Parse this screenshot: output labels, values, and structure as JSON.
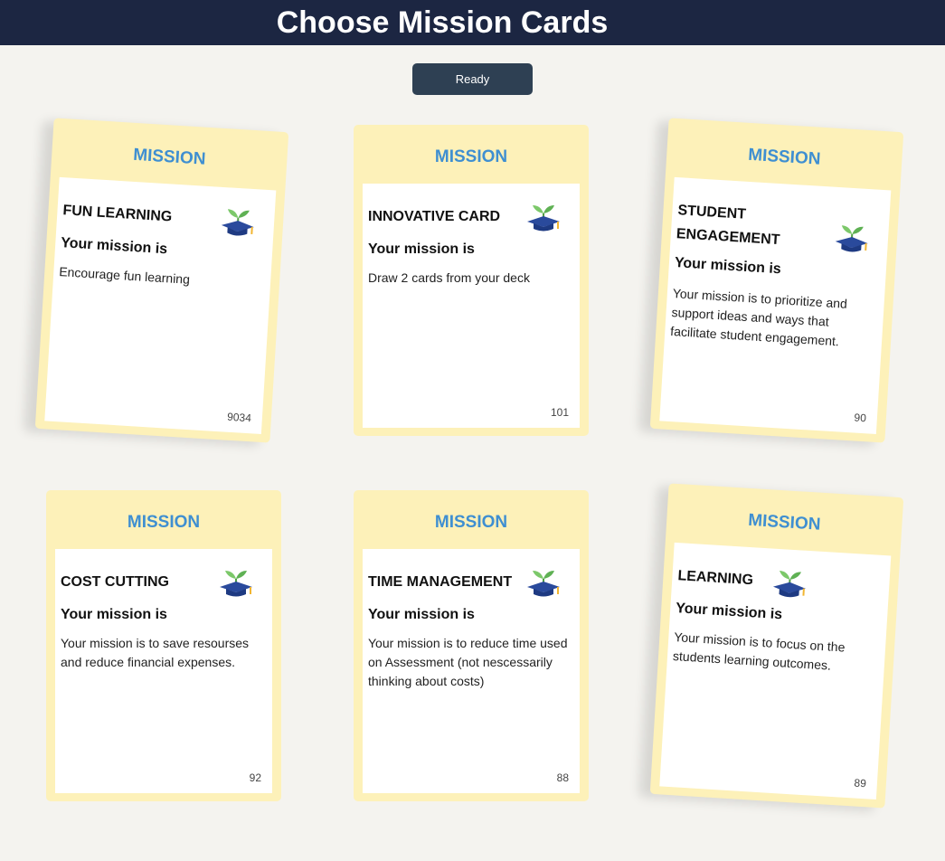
{
  "header": {
    "title": "Choose Mission Cards"
  },
  "ready_button": {
    "label": "Ready"
  },
  "cards": [
    {
      "heading": "MISSION",
      "title": "FUN LEARNING",
      "subtitle": "Your mission is",
      "description": "Encourage fun learning",
      "number": "9034",
      "icon": "graduation-cap-sprout-icon"
    },
    {
      "heading": "MISSION",
      "title": "INNOVATIVE CARD",
      "subtitle": "Your mission is",
      "description": "Draw 2 cards from your deck",
      "number": "101",
      "icon": "graduation-cap-sprout-icon"
    },
    {
      "heading": "MISSION",
      "title": "STUDENT ENGAGEMENT",
      "subtitle": "Your mission is",
      "description": "Your mission is to prioritize and support ideas and ways that facilitate student engagement.",
      "number": "90",
      "icon": "graduation-cap-sprout-icon"
    },
    {
      "heading": "MISSION",
      "title": "COST CUTTING",
      "subtitle": "Your mission is",
      "description": "Your mission is to save resourses and reduce financial expenses.",
      "number": "92",
      "icon": "graduation-cap-sprout-icon"
    },
    {
      "heading": "MISSION",
      "title": "TIME MANAGEMENT",
      "subtitle": "Your mission is",
      "description": "Your mission is to reduce time used on Assessment (not nescessarily thinking about costs)",
      "number": "88",
      "icon": "graduation-cap-sprout-icon"
    },
    {
      "heading": "MISSION",
      "title": "LEARNING",
      "subtitle": "Your mission is",
      "description": "Your mission is to focus on the students learning outcomes.",
      "number": "89",
      "icon": "graduation-cap-sprout-icon"
    }
  ],
  "colors": {
    "header_bg": "#1c2642",
    "page_bg": "#f4f3ef",
    "card_bg": "#fdf1b9",
    "heading_blue": "#3f8fd1",
    "button_bg": "#2e4053"
  }
}
